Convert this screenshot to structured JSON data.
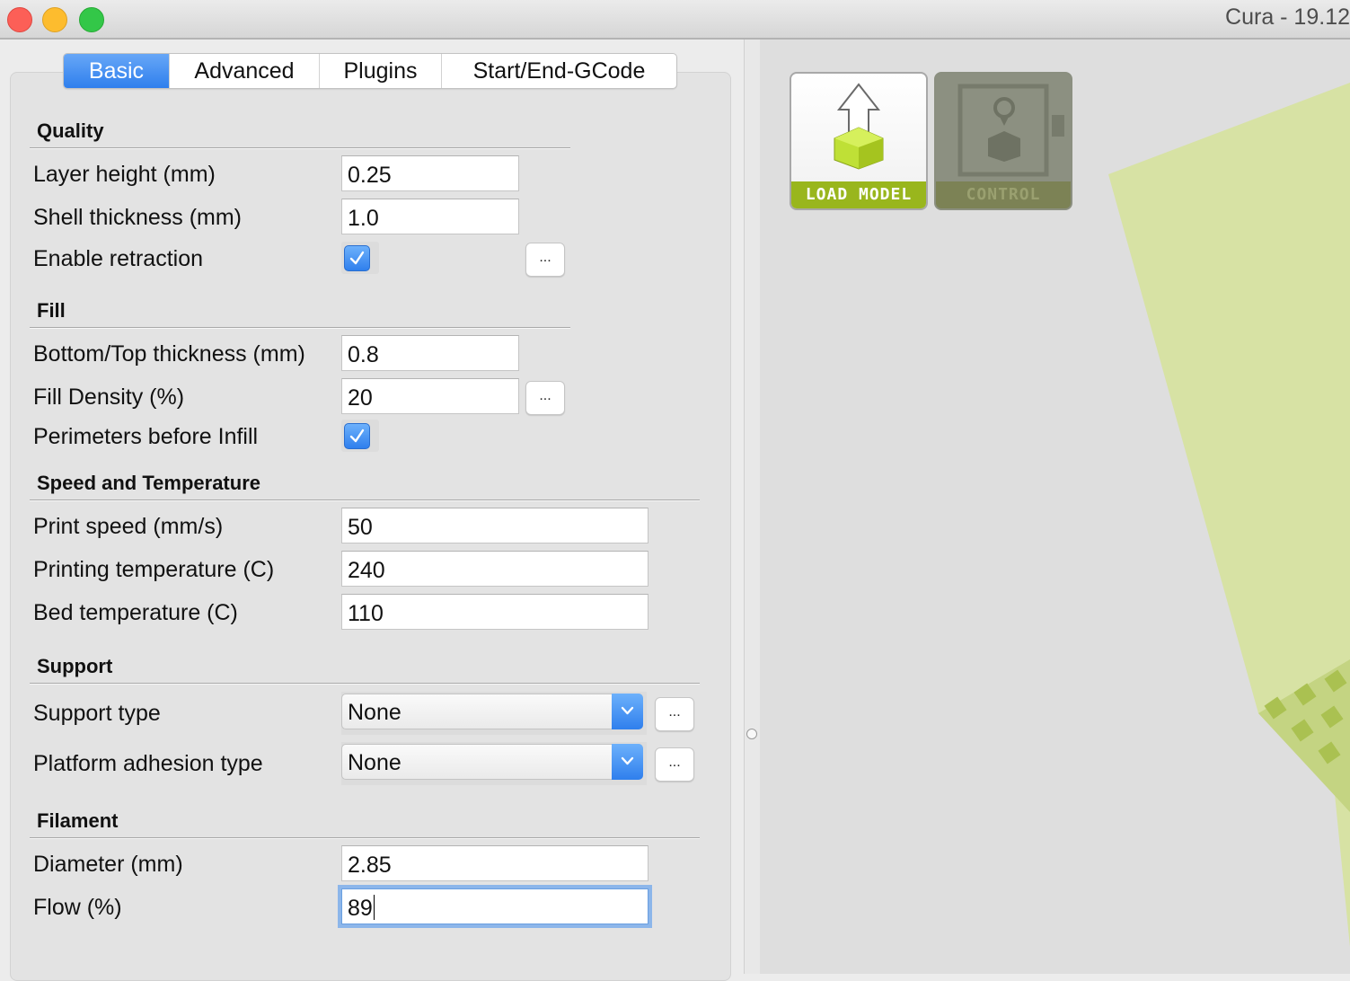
{
  "window": {
    "title": "Cura - 19.12"
  },
  "tabs": [
    {
      "label": "Basic",
      "active": true
    },
    {
      "label": "Advanced",
      "active": false
    },
    {
      "label": "Plugins",
      "active": false
    },
    {
      "label": "Start/End-GCode",
      "active": false
    }
  ],
  "quality": {
    "header": "Quality",
    "layer_height_label": "Layer height (mm)",
    "layer_height_value": "0.25",
    "shell_thickness_label": "Shell thickness (mm)",
    "shell_thickness_value": "1.0",
    "enable_retraction_label": "Enable retraction",
    "enable_retraction_checked": true,
    "more_button": "..."
  },
  "fill": {
    "header": "Fill",
    "bottom_top_label": "Bottom/Top thickness (mm)",
    "bottom_top_value": "0.8",
    "fill_density_label": "Fill Density (%)",
    "fill_density_value": "20",
    "more_button": "...",
    "perimeters_label": "Perimeters before Infill",
    "perimeters_checked": true
  },
  "speed": {
    "header": "Speed and Temperature",
    "print_speed_label": "Print speed (mm/s)",
    "print_speed_value": "50",
    "print_temp_label": "Printing temperature (C)",
    "print_temp_value": "240",
    "bed_temp_label": "Bed temperature (C)",
    "bed_temp_value": "110"
  },
  "support": {
    "header": "Support",
    "support_type_label": "Support type",
    "support_type_value": "None",
    "adhesion_label": "Platform adhesion type",
    "adhesion_value": "None",
    "more_button": "..."
  },
  "filament": {
    "header": "Filament",
    "diameter_label": "Diameter (mm)",
    "diameter_value": "2.85",
    "flow_label": "Flow (%)",
    "flow_value": "89"
  },
  "viewport": {
    "load_model_label": "LOAD MODEL",
    "control_label": "CONTROL",
    "accent_color": "#99b61d",
    "bed_color": "#d7e2a4"
  }
}
